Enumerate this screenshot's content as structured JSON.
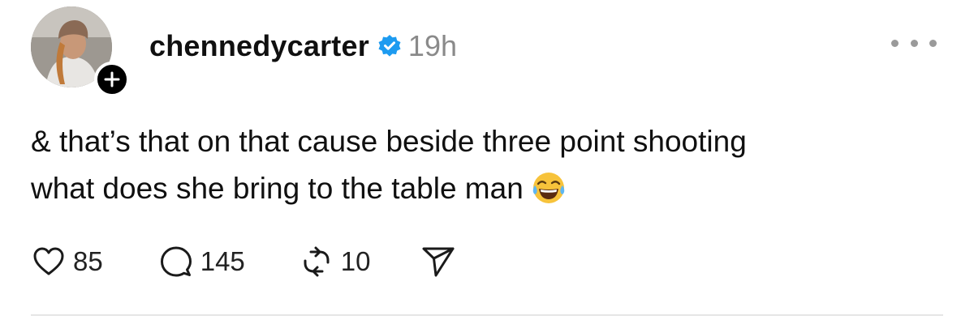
{
  "post": {
    "username": "chennedycarter",
    "timestamp": "19h",
    "text_lines": [
      "& that’s that on that cause beside three point shooting",
      "what does she bring to the table man"
    ],
    "emoji": "face-with-tears-of-joy",
    "actions": {
      "likes": "85",
      "replies": "145",
      "reposts": "10"
    }
  },
  "icons": {
    "verified": "verified-badge-icon",
    "follow": "plus-icon",
    "more": "more-horizontal-icon",
    "like": "heart-icon",
    "reply": "speech-bubble-icon",
    "repost": "repost-icon",
    "share": "send-icon"
  },
  "colors": {
    "verified_blue": "#1d9bf0",
    "timestamp_gray": "#8a8a8a",
    "text": "#101010"
  }
}
